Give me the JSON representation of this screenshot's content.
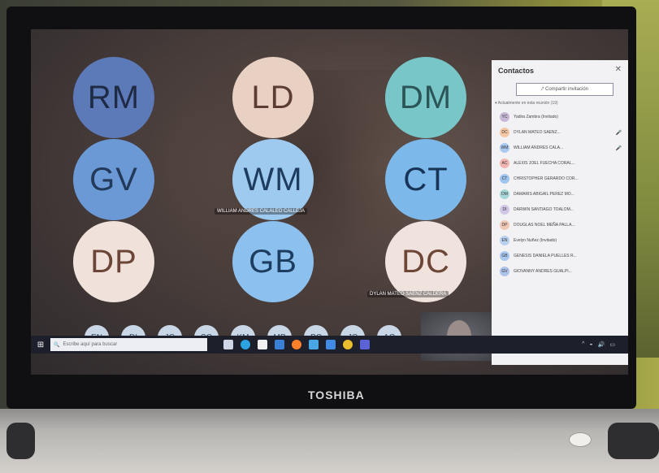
{
  "participants": [
    {
      "initials": "RM",
      "bg": "#5c79b8",
      "fg": "#1f2a44"
    },
    {
      "initials": "LD",
      "bg": "#e8d0c3",
      "fg": "#5b3d34"
    },
    {
      "initials": "DM",
      "bg": "#79c6c9",
      "fg": "#2c5557"
    },
    {
      "initials": "GV",
      "bg": "#6a99d6",
      "fg": "#23395a"
    },
    {
      "initials": "WM",
      "bg": "#9fcaf0",
      "fg": "#1d3c5e"
    },
    {
      "initials": "CT",
      "bg": "#7cb8ea",
      "fg": "#173457"
    },
    {
      "initials": "DP",
      "bg": "#f0e2da",
      "fg": "#6a4538"
    },
    {
      "initials": "GB",
      "bg": "#8cc1ef",
      "fg": "#1c3d60"
    },
    {
      "initials": "DC",
      "bg": "#f0e2dc",
      "fg": "#6c4738"
    }
  ],
  "name_tags": {
    "wm": "WILLIAM ANDRES CALALEO CALLEJA",
    "dc": "DYLAN MATEO SAENZ CALDERA"
  },
  "thumbnails": [
    "EN",
    "DI",
    "JG",
    "SC",
    "KM",
    "MP",
    "PC",
    "JC",
    "AC"
  ],
  "panel": {
    "title": "Contactos",
    "close_icon": "close-icon",
    "share_label": "Compartir invitación",
    "section_label": "▾ Actualmente en esta reunión (19)",
    "contacts": [
      {
        "initials": "YC",
        "name": "Yadira Zambra (Invitado)",
        "color": "#c6b8d6"
      },
      {
        "initials": "DC",
        "name": "DYLAN MATEO SAENZ...",
        "color": "#f4c7a4"
      },
      {
        "initials": "WM",
        "name": "WILLIAM ANDRES CALA...",
        "color": "#a9c9f0"
      },
      {
        "initials": "AC",
        "name": "ALEXIS JOEL FUECHA CORAL...",
        "color": "#f2b6b2"
      },
      {
        "initials": "CT",
        "name": "CHRISTOPHER GERARDO COR...",
        "color": "#9fc5ef"
      },
      {
        "initials": "DM",
        "name": "DAMARIS ABIGAIL PEREZ MO...",
        "color": "#a7d7d8"
      },
      {
        "initials": "DI",
        "name": "DARWIN SANTIAGO TOALOM...",
        "color": "#d2c6e6"
      },
      {
        "initials": "DP",
        "name": "DOUGLAS NOEL MEÑA PALLA...",
        "color": "#f0c9b6"
      },
      {
        "initials": "EN",
        "name": "Evelyn Nuñez (Invitado)",
        "color": "#b9d0ee"
      },
      {
        "initials": "GB",
        "name": "GENESIS DANIELA PUELLES R...",
        "color": "#a9c8ef"
      },
      {
        "initials": "GV",
        "name": "GIOVANNY ANDRES GUALPI...",
        "color": "#aec3ea"
      }
    ]
  },
  "taskbar": {
    "search_placeholder": "Escribe aquí para buscar",
    "icons": [
      "task-view-icon",
      "edge-icon",
      "store-icon",
      "mail-icon",
      "firefox-icon",
      "photos-icon",
      "calendar-icon",
      "chrome-icon",
      "teams-icon"
    ]
  },
  "brand": "TOSHIBA"
}
